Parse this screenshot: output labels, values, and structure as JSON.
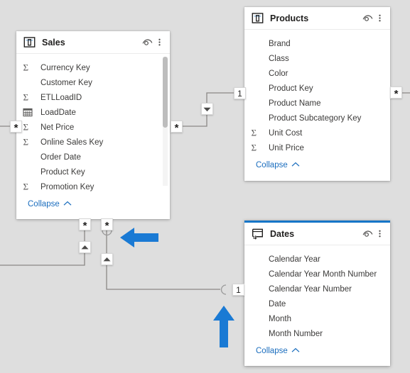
{
  "app": {
    "view": "model-view",
    "canvas_bg": "#dedede",
    "accent": "#1676c8",
    "link_color": "#1a6dbe",
    "annotation_color": "#1a7ad4"
  },
  "tables": [
    {
      "id": "sales",
      "name": "Sales",
      "icon": "table-icon",
      "selected": false,
      "collapse_label": "Collapse",
      "has_scrollbar": true,
      "fields": [
        {
          "name": "Currency Key",
          "icon": "sigma-icon"
        },
        {
          "name": "Customer Key",
          "icon": "none"
        },
        {
          "name": "ETLLoadID",
          "icon": "sigma-icon"
        },
        {
          "name": "LoadDate",
          "icon": "calendar-icon"
        },
        {
          "name": "Net Price",
          "icon": "sigma-icon"
        },
        {
          "name": "Online Sales Key",
          "icon": "sigma-icon"
        },
        {
          "name": "Order Date",
          "icon": "none"
        },
        {
          "name": "Product Key",
          "icon": "none"
        },
        {
          "name": "Promotion Key",
          "icon": "sigma-icon"
        }
      ]
    },
    {
      "id": "products",
      "name": "Products",
      "icon": "table-icon",
      "selected": false,
      "collapse_label": "Collapse",
      "has_scrollbar": false,
      "fields": [
        {
          "name": "Brand",
          "icon": "none"
        },
        {
          "name": "Class",
          "icon": "none"
        },
        {
          "name": "Color",
          "icon": "none"
        },
        {
          "name": "Product Key",
          "icon": "none"
        },
        {
          "name": "Product Name",
          "icon": "none"
        },
        {
          "name": "Product Subcategory Key",
          "icon": "none"
        },
        {
          "name": "Unit Cost",
          "icon": "sigma-icon"
        },
        {
          "name": "Unit Price",
          "icon": "sigma-icon"
        }
      ]
    },
    {
      "id": "dates",
      "name": "Dates",
      "icon": "date-table-icon",
      "selected": true,
      "collapse_label": "Collapse",
      "has_scrollbar": false,
      "fields": [
        {
          "name": "Calendar Year",
          "icon": "none"
        },
        {
          "name": "Calendar Year Month Number",
          "icon": "none"
        },
        {
          "name": "Calendar Year Number",
          "icon": "none"
        },
        {
          "name": "Date",
          "icon": "none"
        },
        {
          "name": "Month",
          "icon": "none"
        },
        {
          "name": "Month Number",
          "icon": "none"
        }
      ]
    }
  ],
  "header_icons": {
    "hide_label": "hide-eye-icon",
    "menu_label": "more-options-icon"
  },
  "relationship_badges": [
    {
      "id": "sales-left-many",
      "label": "*",
      "kind": "many"
    },
    {
      "id": "sales-right-many",
      "label": "*",
      "kind": "many"
    },
    {
      "id": "products-right-many",
      "label": "*",
      "kind": "many"
    },
    {
      "id": "products-left-one",
      "label": "1",
      "kind": "one"
    },
    {
      "id": "sales-bottom-many-1",
      "label": "*",
      "kind": "many"
    },
    {
      "id": "sales-bottom-many-2",
      "label": "*",
      "kind": "many"
    },
    {
      "id": "dates-left-one",
      "label": "1",
      "kind": "one"
    }
  ],
  "direction_badges": [
    {
      "id": "dir-sales-products",
      "glyph": "down-arrow-icon"
    },
    {
      "id": "dir-sales-left",
      "glyph": "up-arrow-icon"
    },
    {
      "id": "dir-sales-dates",
      "glyph": "up-arrow-icon"
    }
  ],
  "annotations": [
    {
      "id": "arrow-left",
      "shape": "left-arrow",
      "target": "inactive-relationship-marker"
    },
    {
      "id": "arrow-up",
      "shape": "up-arrow",
      "target": "dates-relationship-endpoint"
    }
  ]
}
